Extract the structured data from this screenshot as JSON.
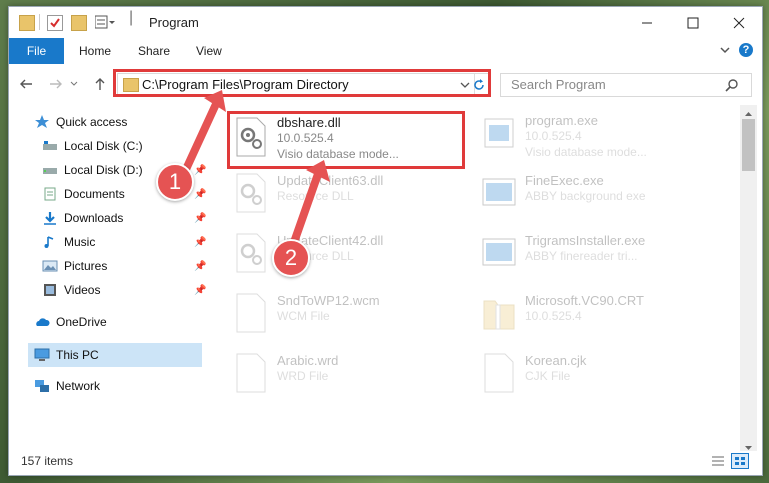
{
  "window": {
    "title": "Program"
  },
  "ribbon": {
    "tabs": [
      "File",
      "Home",
      "Share",
      "View"
    ]
  },
  "address": {
    "path": "C:\\Program Files\\Program Directory"
  },
  "search": {
    "placeholder": "Search Program"
  },
  "sidebar": {
    "items": [
      {
        "label": "Quick access",
        "icon": "star-icon"
      },
      {
        "label": "Local Disk (C:)",
        "icon": "drive-icon"
      },
      {
        "label": "Local Disk (D:)",
        "icon": "drive-icon"
      },
      {
        "label": "Documents",
        "icon": "documents-icon"
      },
      {
        "label": "Downloads",
        "icon": "downloads-icon"
      },
      {
        "label": "Music",
        "icon": "music-icon"
      },
      {
        "label": "Pictures",
        "icon": "pictures-icon"
      },
      {
        "label": "Videos",
        "icon": "videos-icon"
      },
      {
        "label": "OneDrive",
        "icon": "cloud-icon"
      },
      {
        "label": "This PC",
        "icon": "computer-icon"
      },
      {
        "label": "Network",
        "icon": "network-icon"
      }
    ]
  },
  "files": {
    "left": [
      {
        "name": "dbshare.dll",
        "line2": "10.0.525.4",
        "line3": "Visio database mode..."
      },
      {
        "name": "UpdateClient63.dll",
        "line2": "Resource DLL"
      },
      {
        "name": "UpdateClient42.dll",
        "line2": "Resource DLL"
      },
      {
        "name": "SndToWP12.wcm",
        "line2": "WCM File"
      },
      {
        "name": "Arabic.wrd",
        "line2": "WRD File"
      }
    ],
    "right": [
      {
        "name": "program.exe",
        "line2": "10.0.525.4",
        "line3": "Visio database mode..."
      },
      {
        "name": "FineExec.exe",
        "line2": "ABBY background exe"
      },
      {
        "name": "TrigramsInstaller.exe",
        "line2": "ABBY finereader tri..."
      },
      {
        "name": "Microsoft.VC90.CRT",
        "line2": "10.0.525.4"
      },
      {
        "name": "Korean.cjk",
        "line2": "CJK File"
      }
    ]
  },
  "status": {
    "count": "157 items"
  },
  "annotations": {
    "step1": "1",
    "step2": "2"
  },
  "colors": {
    "accent": "#1979ca",
    "highlight": "#e03a3a",
    "selection": "#cce4f7"
  }
}
